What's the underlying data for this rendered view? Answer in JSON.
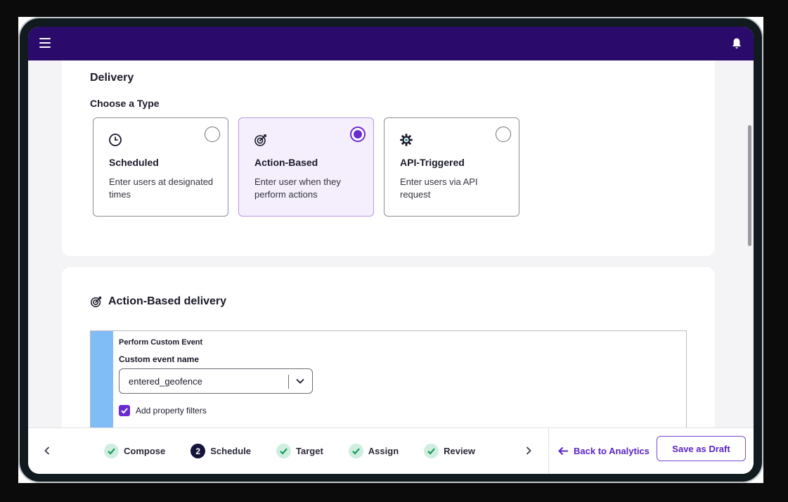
{
  "header": {
    "menu_icon": "hamburger-icon",
    "notification_icon": "bell-icon"
  },
  "delivery": {
    "title": "Delivery",
    "choose_type_label": "Choose a Type",
    "types": [
      {
        "title": "Scheduled",
        "description": "Enter users at designated times",
        "icon": "clock-icon",
        "selected": false
      },
      {
        "title": "Action-Based",
        "description": "Enter user when they perform actions",
        "icon": "target-icon",
        "selected": true
      },
      {
        "title": "API-Triggered",
        "description": "Enter users via API request",
        "icon": "gear-icon",
        "selected": false
      }
    ]
  },
  "action_based": {
    "title": "Action-Based delivery",
    "icon": "target-icon",
    "event_type_label": "Perform Custom Event",
    "custom_event_label": "Custom event name",
    "custom_event_value": "entered_geofence",
    "property_filter_label": "Add property filters",
    "property_filter_checked": true
  },
  "footer": {
    "steps": [
      {
        "label": "Compose",
        "status": "complete"
      },
      {
        "label": "Schedule",
        "status": "current",
        "number": "2"
      },
      {
        "label": "Target",
        "status": "complete"
      },
      {
        "label": "Assign",
        "status": "complete"
      },
      {
        "label": "Review",
        "status": "complete"
      }
    ],
    "back_label": "Back to Analytics",
    "save_draft_label": "Save as Draft"
  },
  "colors": {
    "header_bg": "#2a0a6b",
    "accent": "#6b2bd1",
    "step_complete": "#1a9c5c",
    "event_stripe": "#80bdf7"
  }
}
